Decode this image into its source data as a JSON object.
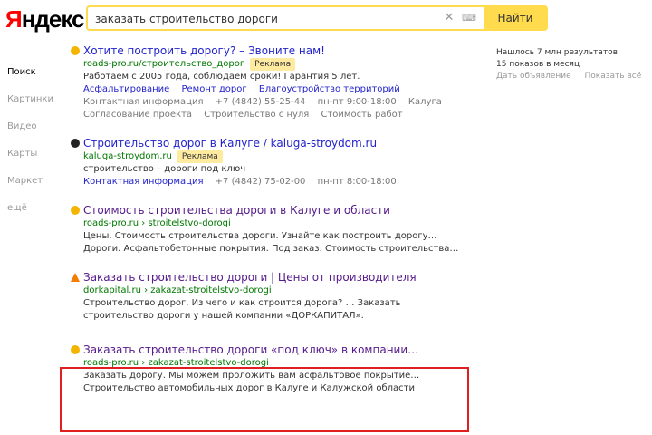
{
  "brand": {
    "logo_first": "Я",
    "logo_rest": "ндекс"
  },
  "search": {
    "query": "заказать строительство дороги",
    "button_label": "Найти",
    "clear_glyph": "✕",
    "kbd_glyph": "⌨"
  },
  "nav": {
    "items": [
      "Поиск",
      "Картинки",
      "Видео",
      "Карты",
      "Маркет",
      "ещё"
    ]
  },
  "results": [
    {
      "title": "Хотите построить дорогу? – Звоните нам!",
      "url": "roads-pro.ru/строительство_дорог",
      "ad_label": "Реклама",
      "snippet": "Работаем с 2005 года, соблюдаем сроки! Гарантия 5 лет.",
      "links1": [
        "Асфальтирование",
        "Ремонт дорог",
        "Благоустройство территорий"
      ],
      "links2": [
        "Контактная информация",
        "+7 (4842) 55-25-44",
        "пн-пт 9:00-18:00",
        "Калуга"
      ],
      "links3": [
        "Согласование проекта",
        "Строительство с нуля",
        "Стоимость работ"
      ]
    },
    {
      "title": "Строительство дорог в Калуге / kaluga-stroydom.ru",
      "url": "kaluga-stroydom.ru",
      "ad_label": "Реклама",
      "snippet": "строительство – дороги под ключ",
      "links1": [
        "Контактная информация",
        "+7 (4842) 75-02-00",
        "пн-пт 8:00-18:00"
      ]
    },
    {
      "title": "Стоимость строительства дороги в Калуге и области",
      "url": "roads-pro.ru › stroitelstvo-dorogi",
      "snippet": "Цены. Стоимость строительства дороги. Узнайте как построить дорогу…",
      "snippet2": "Дороги. Асфальтобетонные покрытия. Под заказ. Стоимость строительства…"
    },
    {
      "title": "Заказать строительство дороги | Цены от производителя",
      "url": "dorkapital.ru › zakazat-stroitelstvo-dorogi",
      "snippet": "Строительство дорог. Из чего и как строится дорога? … Заказать",
      "snippet2": "строительство дороги у нашей компании «ДОРКАПИТАЛ»."
    },
    {
      "title": "Заказать строительство дороги «под ключ» в компании…",
      "url": "roads-pro.ru › zakazat-stroitelstvo-dorogi",
      "snippet": "Заказать дорогу. Мы можем проложить вам асфальтовое покрытие…",
      "snippet2": "Строительство автомобильных дорог в Калуге и Калужской области"
    }
  ],
  "right": {
    "line1": "Нашлось 7 млн результатов",
    "line2": "15 показов в месяц",
    "links": [
      "Дать объявление",
      "Показать всё"
    ]
  },
  "colors": {
    "accent": "#ffdb4d",
    "link": "#2222cc",
    "visited": "#551a8b",
    "url": "#007700",
    "highlight": "#e02020"
  }
}
